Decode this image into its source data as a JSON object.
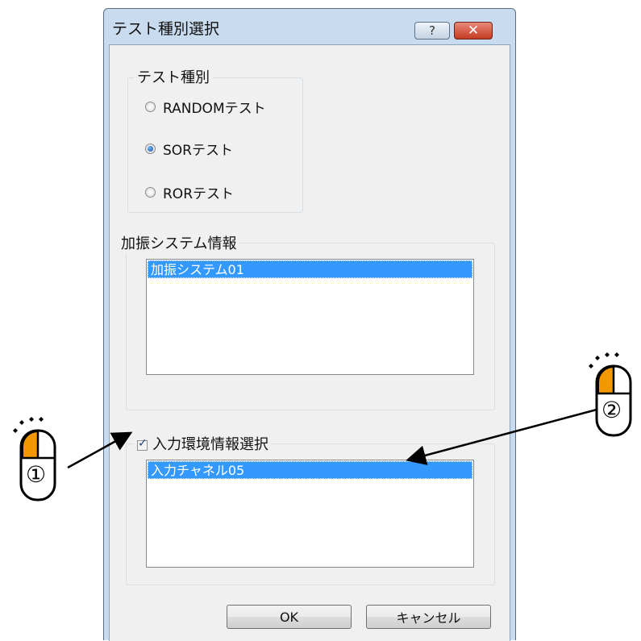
{
  "dialog": {
    "title": "テスト種別選択",
    "help_icon": "?",
    "close_icon": "x"
  },
  "test_type": {
    "legend": "テスト種別",
    "options": [
      {
        "label": "RANDOMテスト",
        "checked": false
      },
      {
        "label": "SORテスト",
        "checked": true
      },
      {
        "label": "RORテスト",
        "checked": false
      }
    ]
  },
  "excitation": {
    "legend": "加振システム情報",
    "items": [
      "加振システム01"
    ]
  },
  "input_env": {
    "checkbox_label": "入力環境情報選択",
    "checked": true,
    "items": [
      "入力チャネル05"
    ]
  },
  "buttons": {
    "ok": "OK",
    "cancel": "キャンセル"
  },
  "annotations": {
    "step1": "①",
    "step2": "②",
    "button_color": "#f39800"
  }
}
